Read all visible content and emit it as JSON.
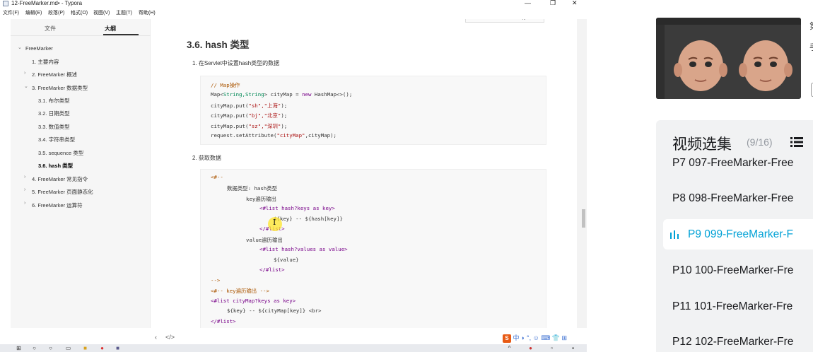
{
  "window": {
    "title": "12-FreeMarker.md• - Typora",
    "controls": {
      "minimize": "—",
      "maximize": "❐",
      "close": "✕"
    }
  },
  "menu": [
    "文件(F)",
    "编辑(E)",
    "段落(P)",
    "格式(O)",
    "视图(V)",
    "主题(T)",
    "帮助(H)"
  ],
  "sidebar": {
    "tabs": [
      "文件",
      "大纲"
    ],
    "outline": [
      {
        "label": "FreeMarker",
        "caret": "⌄"
      },
      {
        "label": "1. 主要内容",
        "caret": ""
      },
      {
        "label": "2. FreeMarker 概述",
        "caret": "›"
      },
      {
        "label": "3. FreeMarker 数据类型",
        "caret": "⌄"
      },
      {
        "label": "3.1. 布尔类型",
        "caret": ""
      },
      {
        "label": "3.2. 日期类型",
        "caret": ""
      },
      {
        "label": "3.3. 数值类型",
        "caret": ""
      },
      {
        "label": "3.4. 字符串类型",
        "caret": ""
      },
      {
        "label": "3.5. sequence 类型",
        "caret": ""
      },
      {
        "label": "3.6. hash 类型",
        "caret": ""
      },
      {
        "label": "4. FreeMarker 常见指令",
        "caret": "›"
      },
      {
        "label": "5. FreeMarker 页面静态化",
        "caret": "›"
      },
      {
        "label": "6. FreeMarker 运算符",
        "caret": "›"
      }
    ]
  },
  "doc": {
    "top_box_label": "存",
    "heading": "3.6. hash 类型",
    "step1": "1. 在Servlet中设置hash类型的数据",
    "code1": {
      "comment": "// Map操作",
      "l1a": "Map<",
      "l1type": "String,String",
      "l1b": "> cityMap = ",
      "l1new": "new",
      "l1c": " HashMap<>();",
      "l2a": "cityMap.put(",
      "l2s": "\"sh\",\"上海\"",
      "l2b": ");",
      "l3a": "cityMap.put(",
      "l3s": "\"bj\",\"北京\"",
      "l3b": ");",
      "l4a": "cityMap.put(",
      "l4s": "\"sz\",\"深圳\"",
      "l4b": ");",
      "l5a": "request.setAttribute(",
      "l5s": "\"cityMap\"",
      "l5b": ",cityMap);"
    },
    "step2": "2. 获取数据",
    "code2": {
      "l1": "<#--",
      "l2": "数据类型: hash类型",
      "l3": "key遍历输出",
      "l4": "<#list hash?keys as key>",
      "l5": "${key} -- ${hash[key]}",
      "l6": "</#list>",
      "l7": "value遍历输出",
      "l8": "<#list hash?values as value>",
      "l9": "${value}",
      "l10": "</#list>",
      "l11": "-->",
      "l12": "<#-- key遍历输出 -->",
      "l13": "<#list cityMap?keys as key>",
      "l14": "${key} -- ${cityMap[key]} <br>",
      "l15": "</#list>"
    }
  },
  "statusbar": {
    "back": "‹",
    "source": "</>"
  },
  "ime": {
    "logo": "S",
    "lang": "中",
    "icons": "◗ °, ☺ ⌨ 👕 ⊞"
  },
  "player": {
    "edge_char_1": "第",
    "edge_char_2": "手",
    "episodes_title": "视频选集",
    "episodes_count": "(9/16)",
    "episodes": [
      {
        "label": "P7   097-FreeMarker-Free",
        "active": false
      },
      {
        "label": "P8   098-FreeMarker-Free",
        "active": false
      },
      {
        "label": "P9   099-FreeMarker-F",
        "active": true
      },
      {
        "label": "P10   100-FreeMarker-Fre",
        "active": false
      },
      {
        "label": "P11   101-FreeMarker-Fre",
        "active": false
      },
      {
        "label": "P12   102-FreeMarker-Fre",
        "active": false
      }
    ]
  },
  "colors": {
    "accent": "#00a1d6",
    "code_keyword": "#770088",
    "code_string": "#aa1111",
    "cursor_highlight": "#ffe628"
  }
}
